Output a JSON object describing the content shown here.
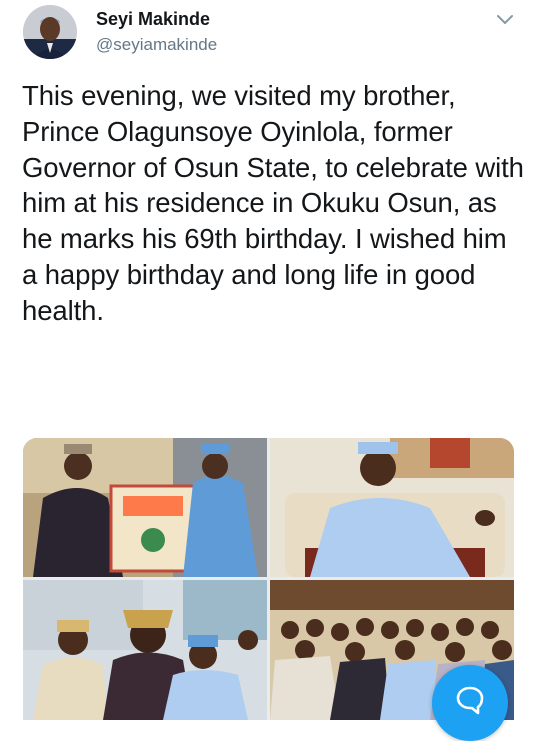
{
  "author": {
    "name": "Seyi Makinde",
    "handle": "@seyiamakinde"
  },
  "tweet": {
    "text": "This evening, we visited my brother, Prince Olagunsoye Oyinlola, former Governor of Osun State, to celebrate with him at his residence in Okuku Osun, as he marks his 69th birthday. I wished him a happy birthday and long life in good health."
  },
  "media": {
    "photos": [
      {
        "id": "photo-1",
        "subject": "birthday card presentation"
      },
      {
        "id": "photo-2",
        "subject": "seated man in light blue attire"
      },
      {
        "id": "photo-3",
        "subject": "embrace near bus"
      },
      {
        "id": "photo-4",
        "subject": "group photo"
      }
    ]
  },
  "icons": {
    "menu": "chevron-down-icon",
    "compose": "reply-bubble-icon"
  },
  "colors": {
    "accent": "#1da1f2",
    "text": "#14171a",
    "muted": "#657786"
  }
}
